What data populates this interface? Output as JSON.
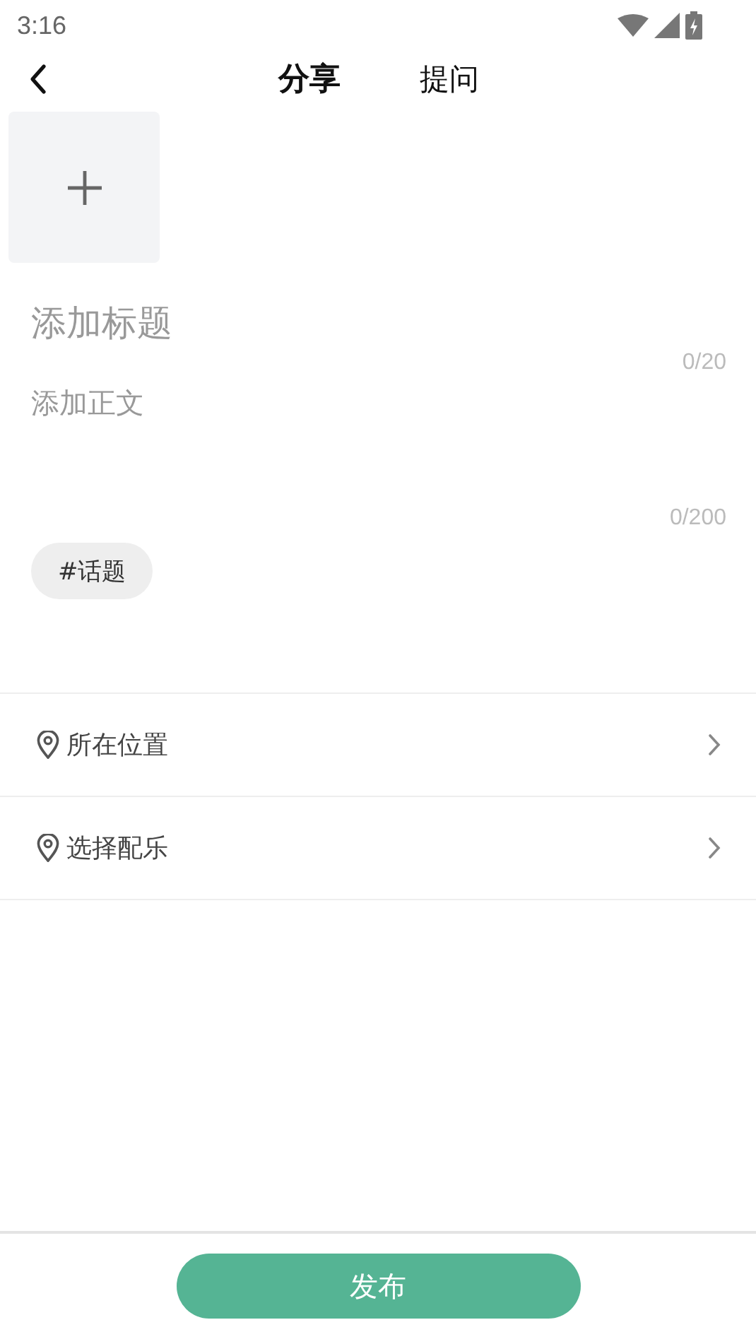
{
  "status_bar": {
    "time": "3:16"
  },
  "tabs": [
    {
      "label": "分享",
      "selected": true
    },
    {
      "label": "提问",
      "selected": false
    }
  ],
  "title_field": {
    "placeholder": "添加标题",
    "counter": "0/20"
  },
  "body_field": {
    "placeholder": "添加正文",
    "counter": "0/200"
  },
  "topic_chip": "#话题",
  "options": [
    {
      "label": "所在位置"
    },
    {
      "label": "选择配乐"
    }
  ],
  "publish_button": "发布"
}
